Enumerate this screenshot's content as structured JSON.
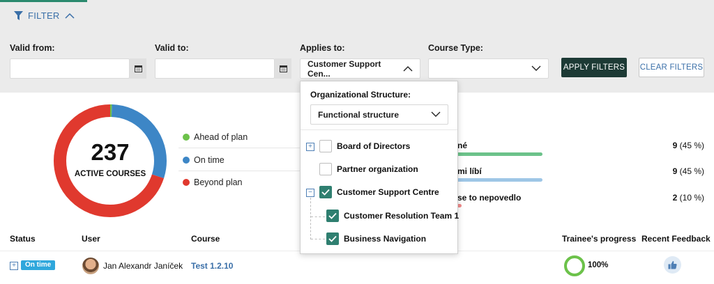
{
  "filter": {
    "toggle_label": "FILTER",
    "valid_from_label": "Valid from:",
    "valid_from_value": "",
    "valid_to_label": "Valid to:",
    "valid_to_value": "",
    "applies_to_label": "Applies to:",
    "applies_to_value": "Customer Support Cen...",
    "course_type_label": "Course Type:",
    "course_type_value": "",
    "apply_label": "APPLY FILTERS",
    "clear_label": "CLEAR FILTERS"
  },
  "summary": {
    "count": "237",
    "caption": "ACTIVE COURSES",
    "segments": [
      {
        "name": "Ahead of plan",
        "value": 0.5,
        "color": "#6cc24a"
      },
      {
        "name": "On time",
        "value": 29.5,
        "color": "#3d86c6"
      },
      {
        "name": "Beyond plan",
        "value": 70,
        "color": "#e0392e"
      }
    ],
    "legend": [
      "Ahead of plan",
      "On time",
      "Beyond plan"
    ]
  },
  "feedback": {
    "items": [
      {
        "label": "né",
        "count": "9",
        "percent": "(45 %)",
        "color": "#6cc28a"
      },
      {
        "label": "mi líbí",
        "count": "9",
        "percent": "(45 %)",
        "color": "#9ec6e6"
      },
      {
        "label": "se to nepovedlo",
        "count": "2",
        "percent": "(10 %)",
        "color": "#f08a8a"
      }
    ]
  },
  "table": {
    "headers": {
      "status": "Status",
      "user": "User",
      "course": "Course",
      "progress": "Trainee's progress",
      "feedback": "Recent Feedback"
    },
    "rows": [
      {
        "status": "On time",
        "user": "Jan Alexandr Janíček",
        "course": "Test 1.2.10",
        "progress": "100%",
        "progress_fraction": 1.0
      }
    ]
  },
  "dropdown": {
    "title": "Organizational Structure:",
    "structure_value": "Functional structure",
    "tree": [
      {
        "label": "Board of Directors",
        "checked": false,
        "expander": "+"
      },
      {
        "label": "Partner organization",
        "checked": false
      },
      {
        "label": "Customer Support Centre",
        "checked": true,
        "expander": "−"
      },
      {
        "label": "Customer Resolution Team 1",
        "checked": true
      },
      {
        "label": "Business Navigation",
        "checked": true
      }
    ]
  },
  "colors": {
    "accent": "#3a6fa8",
    "apply_button": "#1d3a35",
    "checkbox_checked": "#2f7f70",
    "status_badge": "#2fa7dc",
    "progress": "#6cc24a"
  }
}
